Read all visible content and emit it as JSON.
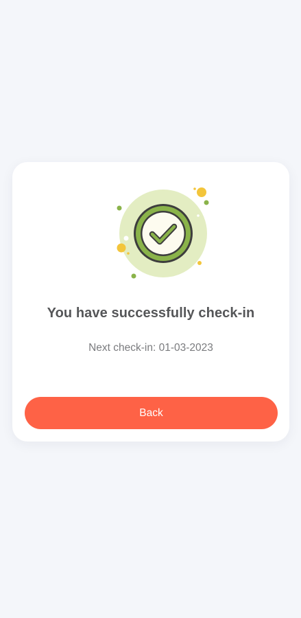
{
  "success": {
    "icon": "check-circle-icon",
    "title": "You have successfully check-in",
    "next_checkin": "Next check-in: 01-03-2023"
  },
  "actions": {
    "back_label": "Back"
  },
  "colors": {
    "background": "#f4f6fa",
    "card": "#ffffff",
    "accent": "#fe6246",
    "icon_green": "#8ab34a",
    "icon_halo": "#e3edc2",
    "dot_yellow": "#f3c53b",
    "title_text": "#555658",
    "subtitle_text": "#7a7b7e"
  }
}
